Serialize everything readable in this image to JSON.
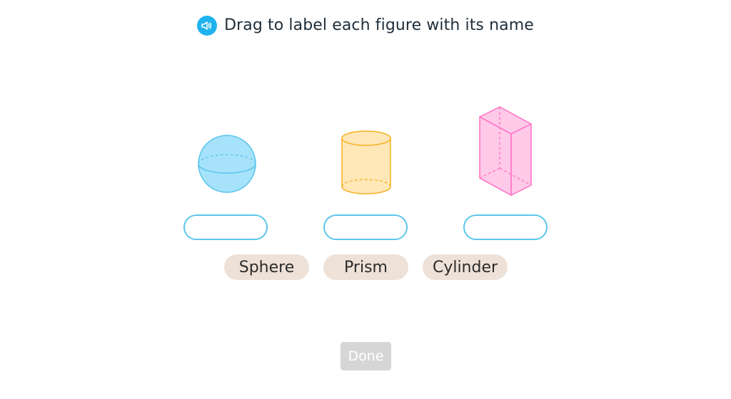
{
  "prompt": {
    "text": "Drag to label each figure with its name",
    "audio_icon": "speaker-icon",
    "audio_color": "#1fb3ee"
  },
  "figures": [
    {
      "name": "sphere",
      "fill": "#a6e3fb",
      "stroke": "#59c3ea"
    },
    {
      "name": "cylinder",
      "fill": "#ffe7b7",
      "stroke": "#f5b01f"
    },
    {
      "name": "rectangular-prism",
      "fill": "#ffc9e8",
      "stroke": "#ff6fc4"
    }
  ],
  "drop_slots": [
    {
      "value": ""
    },
    {
      "value": ""
    },
    {
      "value": ""
    }
  ],
  "answer_chips": [
    {
      "label": "Sphere"
    },
    {
      "label": "Prism"
    },
    {
      "label": "Cylinder"
    }
  ],
  "done_button": {
    "label": "Done",
    "enabled": false
  },
  "colors": {
    "slot_border": "#5cc6ea",
    "chip_background": "#eee1d7",
    "done_disabled": "#d6d6d6"
  }
}
